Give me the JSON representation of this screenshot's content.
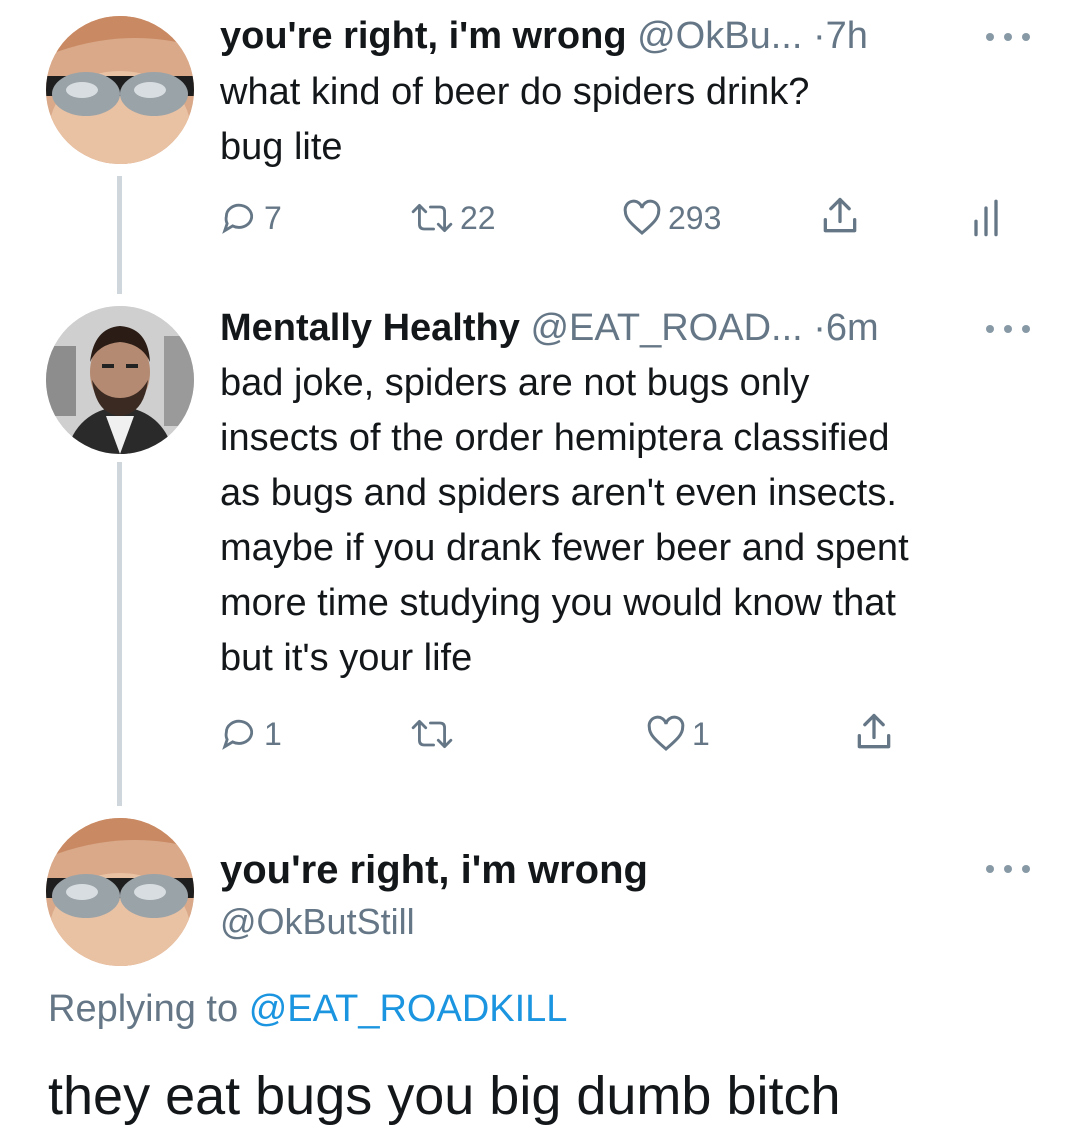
{
  "tweets": [
    {
      "name": "you're right, i'm wrong",
      "handle": "@OkBu...",
      "dot": "·",
      "time": "7h",
      "lines": [
        "what kind of beer do spiders drink?",
        "bug lite"
      ],
      "actions": {
        "reply_count": "7",
        "retweet_count": "22",
        "like_count": "293"
      },
      "avatar_icon": "sunglasses-avatar"
    },
    {
      "name": "Mentally Healthy",
      "handle": "@EAT_ROAD...",
      "dot": "·",
      "time": "6m",
      "lines": [
        "bad joke, spiders are not bugs only",
        "insects of the order hemiptera classified",
        "as bugs and spiders aren't even insects.",
        "maybe if you drank fewer beer and spent",
        "more time studying you would know that",
        "but it's your life"
      ],
      "actions": {
        "reply_count": "1",
        "retweet_count": "",
        "like_count": "1"
      },
      "avatar_icon": "bearded-man-avatar"
    }
  ],
  "main_tweet": {
    "name": "you're right, i'm wrong",
    "handle": "@OkButStill",
    "replying_prefix": "Replying to",
    "replying_to": "@EAT_ROADKILL",
    "text": "they eat bugs you big dumb bitch"
  },
  "colors": {
    "text": "#14171a",
    "muted": "#657786",
    "link": "#1b95e0",
    "thread_line": "#cfd6dc"
  },
  "icons": [
    "reply-icon",
    "retweet-icon",
    "like-icon",
    "share-icon",
    "analytics-icon",
    "more-icon"
  ]
}
